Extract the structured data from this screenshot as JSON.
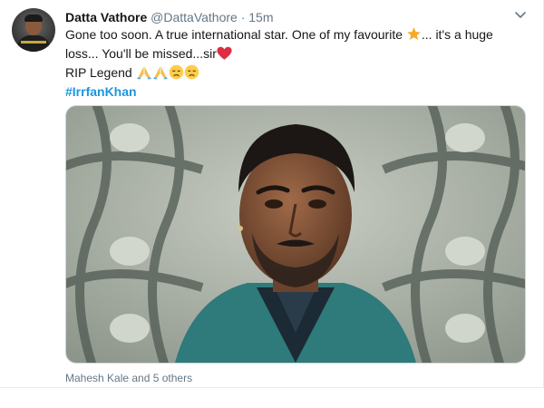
{
  "tweet": {
    "author_name": "Datta Vathore",
    "author_handle": "@DattaVathore",
    "separator": "·",
    "timestamp": "15m",
    "text_line1_part1": "Gone too soon. A true international star. One of my favourite ",
    "text_line1_part2": "... it's a huge",
    "text_line2": "loss... You'll be missed...sir",
    "text_line3": "RIP Legend ",
    "hashtag": "#IrrfanKhan",
    "liked_by": "Mahesh Kale and 5 others"
  },
  "icons": {
    "star": "star-emoji",
    "heart": "red-heart-emoji",
    "folded_hands": "folded-hands-emoji",
    "disappointed": "disappointed-face-emoji",
    "caret": "chevron-down-icon"
  },
  "colors": {
    "link": "#1b95e0",
    "secondary_text": "#657786",
    "primary_text": "#14171a",
    "heart": "#e0245e",
    "star": "#f4a92a"
  }
}
